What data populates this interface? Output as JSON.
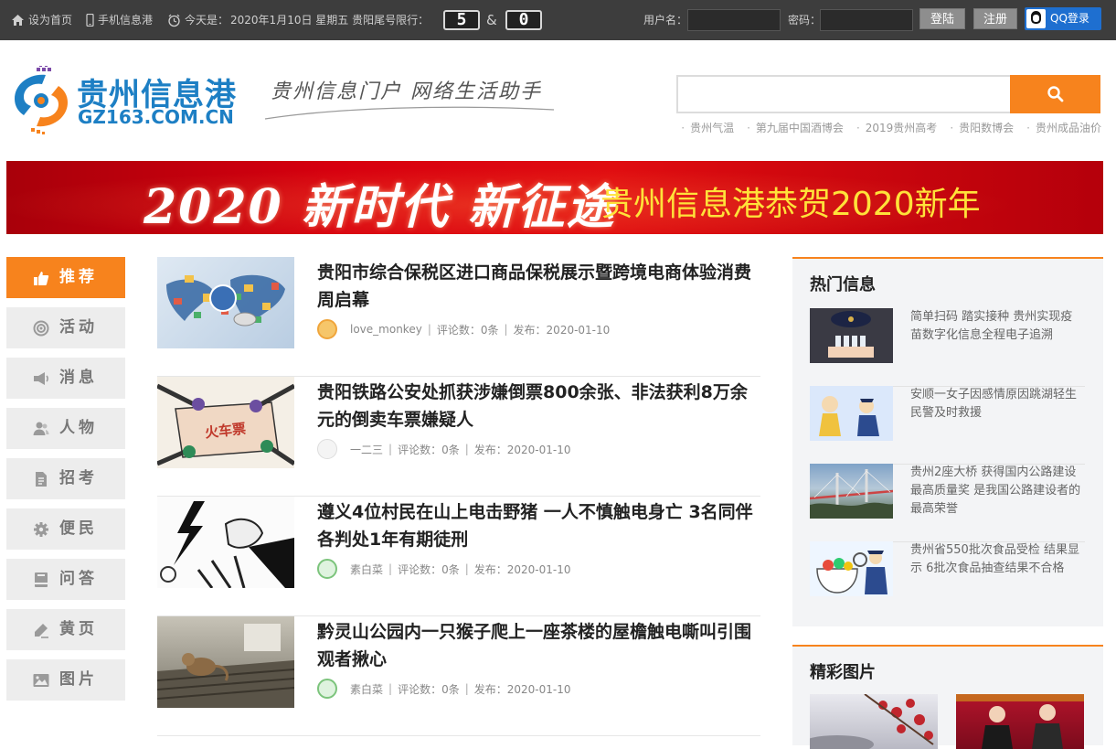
{
  "topbar": {
    "set_home": "设为首页",
    "mobile": "手机信息港",
    "today_label": "今天是：",
    "date_text": "2020年1月10日 星期五 贵阳尾号限行：",
    "plate_a": "5",
    "plate_amp": "&",
    "plate_b": "0",
    "username_label": "用户名：",
    "password_label": "密码：",
    "login_button": "登陆",
    "register_button": "注册",
    "qq_login": "QQ登录"
  },
  "header": {
    "logo_cn": "贵州信息港",
    "logo_en": "GZ163.COM.CN",
    "slogan": "贵州信息门户  网络生活助手",
    "search_placeholder": "",
    "hot_links": [
      "贵州气温",
      "第九届中国酒博会",
      "2019贵州高考",
      "贵阳数博会",
      "贵州成品油价"
    ]
  },
  "banner": {
    "big_text": "2020 新时代 新征途",
    "right_text": "贵州信息港恭贺2020新年"
  },
  "nav": [
    {
      "label": "推荐",
      "icon": "thumbs-up-icon"
    },
    {
      "label": "活动",
      "icon": "target-icon"
    },
    {
      "label": "消息",
      "icon": "megaphone-icon"
    },
    {
      "label": "人物",
      "icon": "users-icon"
    },
    {
      "label": "招考",
      "icon": "document-icon"
    },
    {
      "label": "便民",
      "icon": "gear-icon"
    },
    {
      "label": "问答",
      "icon": "book-icon"
    },
    {
      "label": "黄页",
      "icon": "edit-icon"
    },
    {
      "label": "图片",
      "icon": "image-icon"
    }
  ],
  "articles": [
    {
      "title": "贵阳市综合保税区进口商品保税展示暨跨境电商体验消费周启幕",
      "author": "love_monkey",
      "comments": "评论数：0条",
      "published": "发布：2020-01-10"
    },
    {
      "title": "贵阳铁路公安处抓获涉嫌倒票800余张、非法获利8万余元的倒卖车票嫌疑人",
      "author": "一二三",
      "comments": "评论数：0条",
      "published": "发布：2020-01-10",
      "thumb_text": "火车票"
    },
    {
      "title": "遵义4位村民在山上电击野猪 一人不慎触电身亡 3名同伴各判处1年有期徒刑",
      "author": "素白菜",
      "comments": "评论数：0条",
      "published": "发布：2020-01-10"
    },
    {
      "title": "黔灵山公园内一只猴子爬上一座茶楼的屋檐触电嘶叫引围观者揪心",
      "author": "素白菜",
      "comments": "评论数：0条",
      "published": "发布：2020-01-10"
    }
  ],
  "hot": {
    "title": "热门信息",
    "items": [
      {
        "text": "简单扫码 踏实接种 贵州实现疫苗数字化信息全程电子追溯"
      },
      {
        "text": "安顺一女子因感情原因跳湖轻生 民警及时救援"
      },
      {
        "text": "贵州2座大桥 获得国内公路建设最高质量奖 是我国公路建设者的最高荣誉"
      },
      {
        "text": "贵州省550批次食品受检 结果显示 6批次食品抽查结果不合格"
      }
    ]
  },
  "pictures": {
    "title": "精彩图片"
  },
  "colors": {
    "accent": "#f7831d",
    "topbar": "#3d3d3d",
    "brand_blue": "#1d7fc4"
  }
}
